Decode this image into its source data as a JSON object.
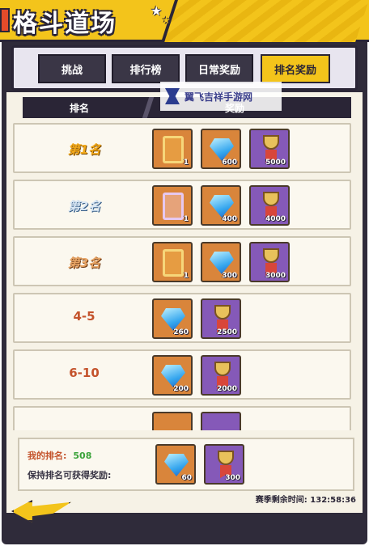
{
  "header": {
    "title": "格斗道场"
  },
  "tabs": [
    {
      "label": "挑战",
      "active": false
    },
    {
      "label": "排行榜",
      "active": false
    },
    {
      "label": "日常奖励",
      "active": false
    },
    {
      "label": "排名奖励",
      "active": true
    }
  ],
  "watermark": {
    "text": "翼飞吉祥手游网"
  },
  "columns": {
    "rank": "排名",
    "reward": "奖励"
  },
  "rows": [
    {
      "rank": "第1名",
      "tier": "gold",
      "rewards": [
        {
          "icon": "frame-icon",
          "type": "orange",
          "qty": "1"
        },
        {
          "icon": "gem-icon",
          "type": "orange",
          "qty": "600"
        },
        {
          "icon": "medal-icon",
          "type": "purple",
          "qty": "5000"
        }
      ]
    },
    {
      "rank": "第2名",
      "tier": "silver",
      "rewards": [
        {
          "icon": "frame-icon",
          "type": "orange",
          "qty": "1"
        },
        {
          "icon": "gem-icon",
          "type": "orange",
          "qty": "400"
        },
        {
          "icon": "medal-icon",
          "type": "purple",
          "qty": "4000"
        }
      ]
    },
    {
      "rank": "第3名",
      "tier": "bronze",
      "rewards": [
        {
          "icon": "frame-icon",
          "type": "orange",
          "qty": "1"
        },
        {
          "icon": "gem-icon",
          "type": "orange",
          "qty": "300"
        },
        {
          "icon": "medal-icon",
          "type": "purple",
          "qty": "3000"
        }
      ]
    },
    {
      "rank": "4-5",
      "tier": "text",
      "rewards": [
        {
          "icon": "gem-icon",
          "type": "orange",
          "qty": "260"
        },
        {
          "icon": "medal-icon",
          "type": "purple",
          "qty": "2500"
        }
      ]
    },
    {
      "rank": "6-10",
      "tier": "text",
      "rewards": [
        {
          "icon": "gem-icon",
          "type": "orange",
          "qty": "200"
        },
        {
          "icon": "medal-icon",
          "type": "purple",
          "qty": "2000"
        }
      ]
    }
  ],
  "my_rank": {
    "label": "我的排名:",
    "value": "508",
    "keep_label": "保持排名可获得奖励:",
    "rewards": [
      {
        "icon": "gem-icon",
        "type": "orange",
        "qty": "60"
      },
      {
        "icon": "medal-icon",
        "type": "purple",
        "qty": "300"
      }
    ]
  },
  "season": {
    "label": "赛季剩余时间:",
    "time": "132:58:36"
  },
  "colors": {
    "accent": "#f3c41b",
    "dark": "#2a2536",
    "rank_red": "#c4532c",
    "green": "#3aa33a"
  }
}
